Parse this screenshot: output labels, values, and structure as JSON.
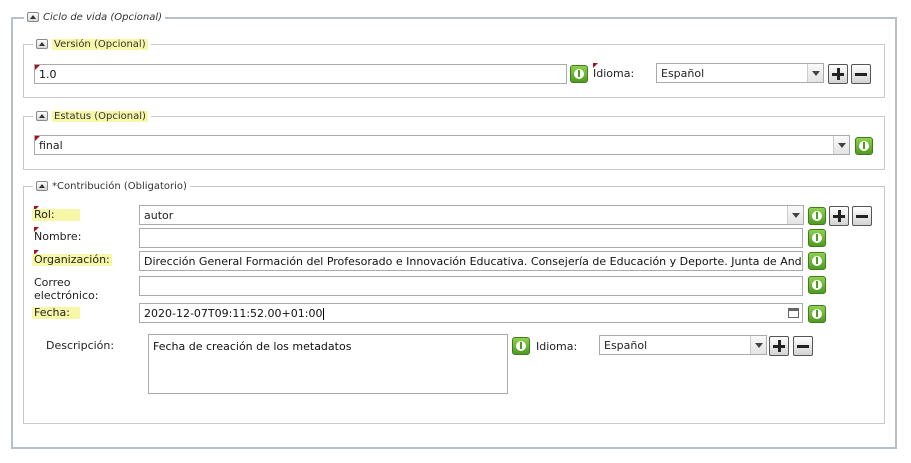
{
  "lifecycle": {
    "legend": "Ciclo de vida (Opcional)",
    "version": {
      "legend": "Versión (Opcional)",
      "value": "1.0",
      "language_label": "Idioma:",
      "language_value": "Español"
    },
    "status": {
      "legend": "Estatus (Opcional)",
      "value": "final"
    },
    "contribution": {
      "legend": "*Contribución (Obligatorio)",
      "role_label": "Rol:",
      "role_value": "autor",
      "name_label": "Nombre:",
      "name_value": "",
      "org_label": "Organización:",
      "org_value": "Dirección General Formación del Profesorado e Innovación Educativa. Consejería de Educación y Deporte. Junta de Andalucí",
      "email_label_1": "Correo",
      "email_label_2": "electrónico:",
      "email_value": "",
      "date_label": "Fecha:",
      "date_value": "2020-12-07T09:11:52.00+01:00",
      "desc_label": "Descripción:",
      "desc_value": "Fecha de creación de los metadatos",
      "desc_language_label": "Idioma:",
      "desc_language_value": "Español"
    }
  },
  "icons": {
    "info": "info-icon",
    "add": "plus-icon",
    "remove": "minus-icon",
    "collapse": "collapse-up-icon",
    "calendar": "calendar-icon",
    "dropdown": "chevron-down-icon"
  }
}
